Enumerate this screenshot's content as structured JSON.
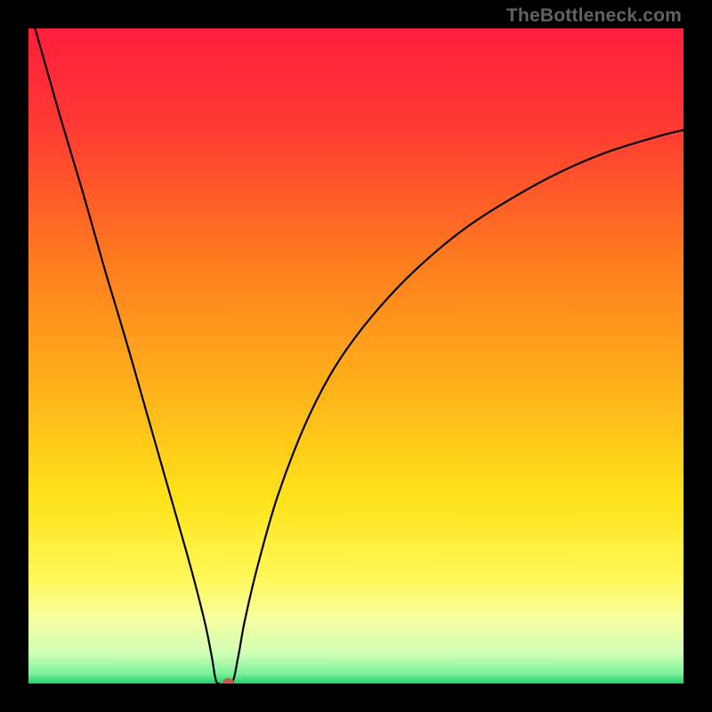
{
  "watermark": "TheBottleneck.com",
  "colors": {
    "black": "#000000",
    "curve": "#000000",
    "marker": "#c55a4a"
  },
  "chart_data": {
    "type": "line",
    "title": "",
    "xlabel": "",
    "ylabel": "",
    "x_range": [
      0,
      100
    ],
    "y_range": [
      0,
      100
    ],
    "curve": {
      "name": "bottleneck_percentage",
      "x": [
        1,
        3,
        5,
        8,
        10,
        12,
        15,
        18,
        20,
        22,
        24,
        25.5,
        27,
        28,
        28.5,
        29,
        31,
        32,
        33,
        35,
        38,
        42,
        46,
        50,
        55,
        60,
        66,
        72,
        80,
        88,
        96,
        100
      ],
      "y": [
        100,
        93,
        86,
        76,
        69,
        62,
        52,
        41.5,
        34.5,
        27.5,
        20.5,
        15,
        9,
        4,
        1,
        0,
        0,
        4,
        9.5,
        18,
        28.5,
        39,
        47,
        53,
        59,
        64,
        69,
        73,
        77.5,
        81,
        83.5,
        84.5
      ]
    },
    "minimum_marker": {
      "x": 30.5,
      "y": 0
    },
    "gradient_stops": [
      {
        "offset": 0.0,
        "color": "#ff1e3c"
      },
      {
        "offset": 0.15,
        "color": "#ff3a33"
      },
      {
        "offset": 0.35,
        "color": "#ff7a1f"
      },
      {
        "offset": 0.55,
        "color": "#ffb21a"
      },
      {
        "offset": 0.72,
        "color": "#ffe31a"
      },
      {
        "offset": 0.84,
        "color": "#fff85a"
      },
      {
        "offset": 0.9,
        "color": "#f6ffa0"
      },
      {
        "offset": 0.955,
        "color": "#cfffb4"
      },
      {
        "offset": 0.985,
        "color": "#7af09a"
      },
      {
        "offset": 1.0,
        "color": "#1fd26a"
      }
    ]
  }
}
